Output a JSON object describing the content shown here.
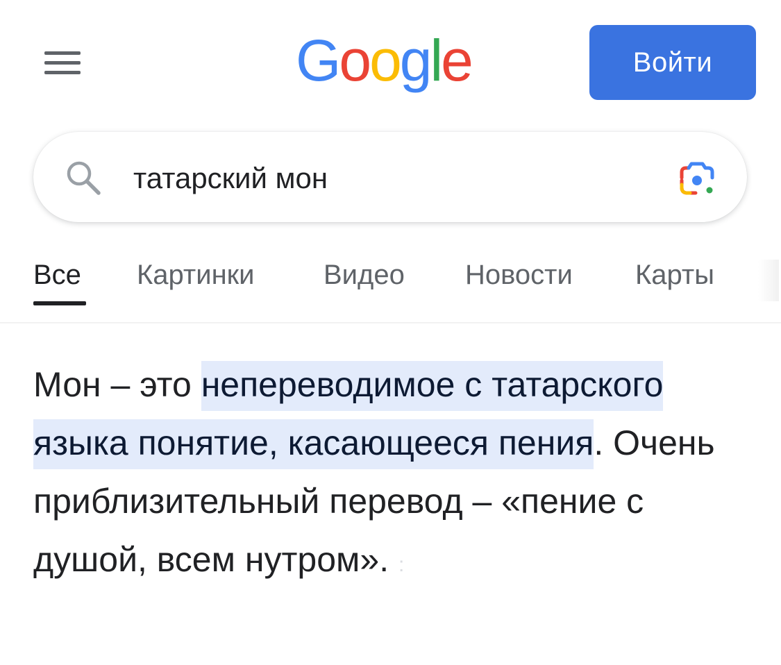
{
  "header": {
    "logo_text": "Google",
    "login_label": "Войти"
  },
  "search": {
    "query": "татарский мон",
    "placeholder": ""
  },
  "tabs": [
    {
      "label": "Все",
      "active": true
    },
    {
      "label": "Картинки",
      "active": false
    },
    {
      "label": "Видео",
      "active": false
    },
    {
      "label": "Новости",
      "active": false
    },
    {
      "label": "Карты",
      "active": false
    }
  ],
  "snippet": {
    "prefix": "Мон – это ",
    "highlight": "непереводимое с татарского языка понятие, касающееся пения",
    "suffix": ". Очень приблизительный перевод – «пение с душой, всем нутром».",
    "trailing_mark": ":"
  },
  "icons": {
    "menu": "hamburger-menu-icon",
    "search": "search-icon",
    "lens": "google-lens-icon"
  },
  "colors": {
    "login_button": "#3a73e0",
    "highlight": "#e3ebfb",
    "google_blue": "#4285F4",
    "google_red": "#EA4335",
    "google_yellow": "#FBBC05",
    "google_green": "#34A853"
  }
}
